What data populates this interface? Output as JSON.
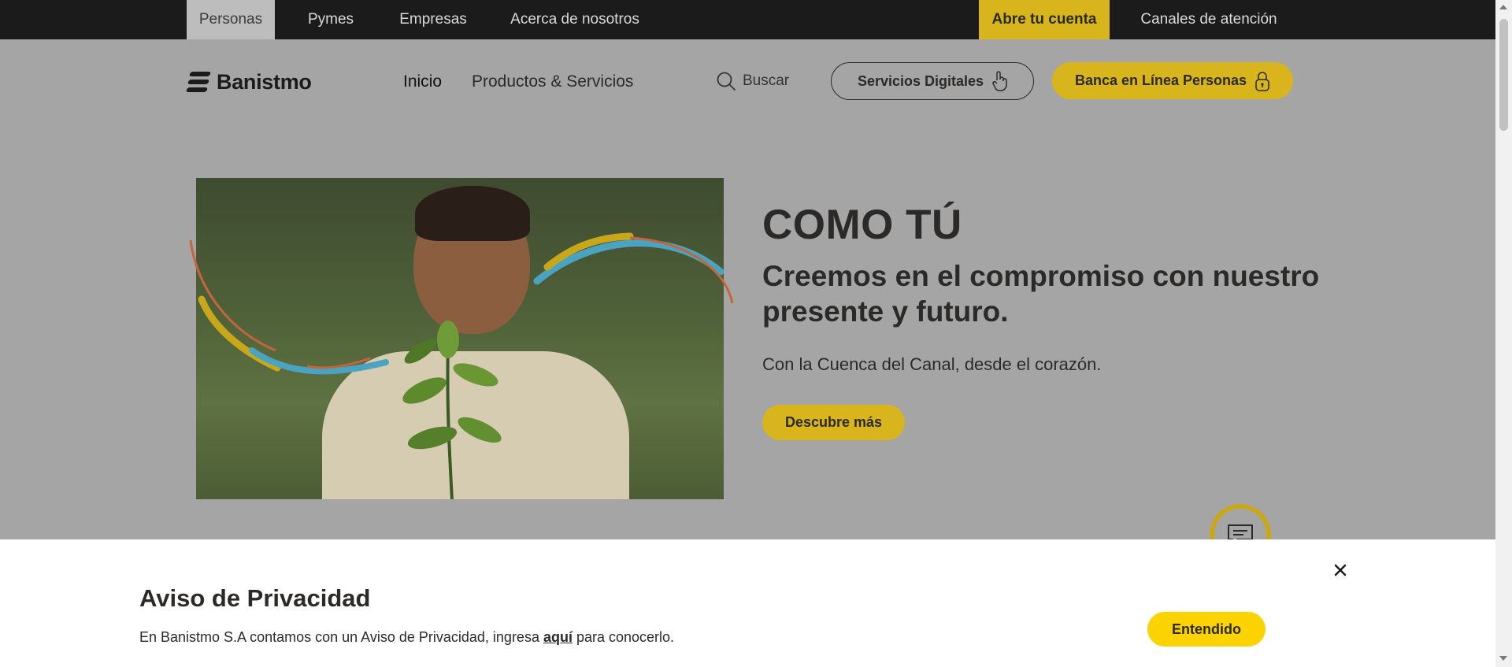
{
  "topbar": {
    "tabs": [
      {
        "label": "Personas"
      },
      {
        "label": "Pymes"
      },
      {
        "label": "Empresas"
      },
      {
        "label": "Acerca de nosotros"
      }
    ],
    "cta": "Abre tu cuenta",
    "channels": "Canales de atención"
  },
  "header": {
    "logo_text": "Banistmo",
    "nav": [
      {
        "label": "Inicio"
      },
      {
        "label": "Productos & Servicios"
      }
    ],
    "search_label": "Buscar",
    "digital_services": "Servicios Digitales",
    "online_banking": "Banca en Línea Personas"
  },
  "hero": {
    "title": "COMO TÚ",
    "subtitle": "Creemos en el compromiso con nuestro presente y futuro.",
    "text": "Con la Cuenca del Canal, desde el corazón.",
    "button": "Descubre más"
  },
  "privacy": {
    "title": "Aviso de Privacidad",
    "text_before": "En Banistmo S.A contamos con un Aviso de Privacidad, ingresa ",
    "link": "aquí",
    "text_after": " para conocerlo.",
    "accept": "Entendido"
  },
  "colors": {
    "brand_yellow": "#d8b51c",
    "accept_yellow": "#fbd300",
    "topbar": "#1b1b1b",
    "overlay_gray": "#a5a5a5"
  },
  "icons": [
    "search-icon",
    "hand-pointer-icon",
    "lock-icon",
    "chat-icon",
    "close-icon"
  ]
}
